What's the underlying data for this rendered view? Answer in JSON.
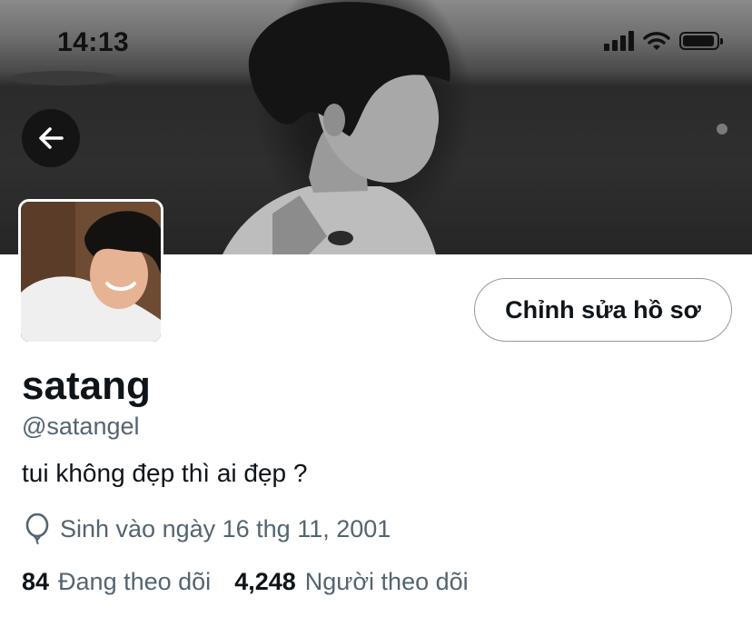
{
  "status_bar": {
    "time": "14:13"
  },
  "profile": {
    "display_name": "satang",
    "handle": "@satangel",
    "bio": "tui không đẹp thì ai đẹp ?",
    "birth_text": "Sinh vào ngày 16 thg 11, 2001",
    "edit_profile_label": "Chỉnh sửa hồ sơ"
  },
  "stats": {
    "following_count": "84",
    "following_label": "Đang theo dõi",
    "followers_count": "4,248",
    "followers_label": "Người theo dõi"
  },
  "icons": {
    "back": "arrow-left-icon",
    "birthday": "balloon-icon",
    "signal": "cellular-signal-icon",
    "wifi": "wifi-icon",
    "battery": "battery-icon"
  },
  "colors": {
    "text_primary": "#0f1419",
    "text_secondary": "#536471",
    "button_border": "#8f9aa3",
    "back_button_bg": "#0f0f0f"
  }
}
